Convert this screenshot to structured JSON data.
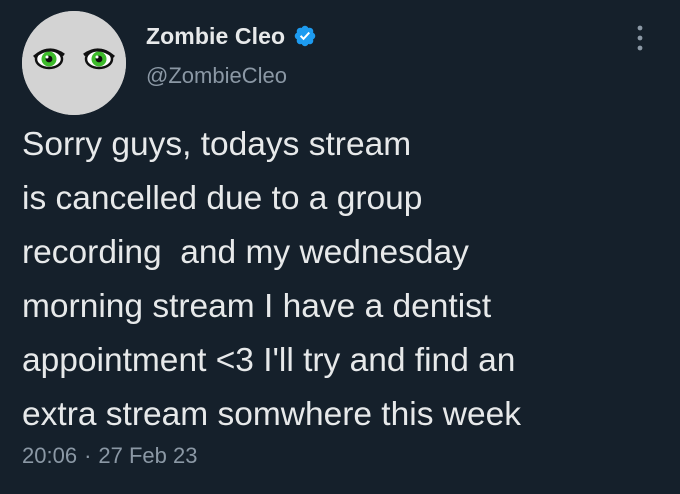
{
  "author": {
    "display_name": "Zombie Cleo",
    "handle": "@ZombieCleo",
    "verified": true
  },
  "tweet": {
    "lines": [
      "Sorry guys, todays stream",
      "is cancelled due to a group",
      "recording  and my wednesday",
      "morning stream I have a dentist",
      "appointment <3 I'll try and find an",
      "extra stream somwhere this week"
    ],
    "time": "20:06",
    "separator": "·",
    "date": "27 Feb 23"
  },
  "icons": {
    "verified": "verified-badge-icon",
    "more": "more-options-icon"
  },
  "colors": {
    "background": "#15202b",
    "text": "#e7e9ea",
    "muted": "#8b98a5",
    "verified": "#1d9bf0",
    "avatar_bg": "#d3d3d3",
    "eye_green": "#3dbb2a"
  }
}
